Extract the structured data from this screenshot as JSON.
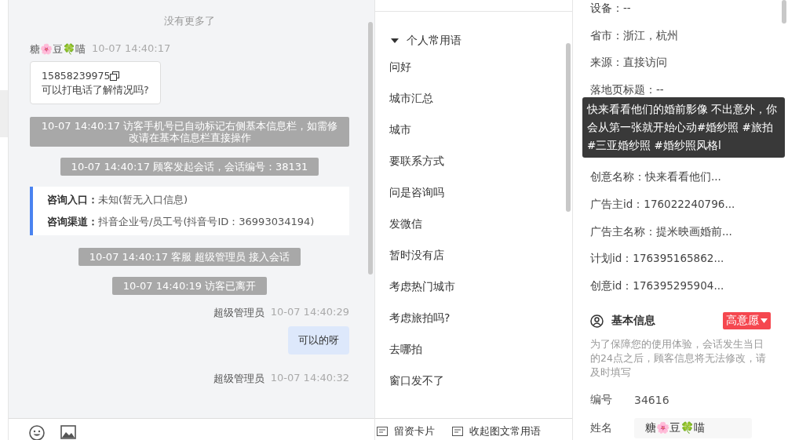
{
  "chat": {
    "no_more": "没有更多了",
    "messages": [
      {
        "kind": "visitor",
        "name": "糖🌸豆🍀喵",
        "time": "10-07 14:40:17",
        "phone": "15858239975",
        "text": "可以打电话了解情况吗?"
      },
      {
        "kind": "system",
        "text": "10-07 14:40:17 访客手机号已自动标记右侧基本信息栏，如需修改请在基本信息栏直接操作"
      },
      {
        "kind": "system",
        "text": "10-07 14:40:17 顾客发起会话，会话编号：38131"
      },
      {
        "kind": "entry",
        "rows": [
          {
            "label": "咨询入口：",
            "value": "未知(暂无入口信息)"
          },
          {
            "label": "咨询渠道：",
            "value": "抖音企业号/员工号(抖音号ID：36993034194)"
          }
        ]
      },
      {
        "kind": "system",
        "text": "10-07 14:40:17 客服 超级管理员 接入会话"
      },
      {
        "kind": "system",
        "text": "10-07 14:40:19 访客已离开"
      },
      {
        "kind": "agent",
        "name": "超级管理员",
        "time": "10-07 14:40:29",
        "text": "可以的呀"
      },
      {
        "kind": "agent",
        "name": "超级管理员",
        "time": "10-07 14:40:32"
      }
    ]
  },
  "phrases": {
    "group": "个人常用语",
    "expanded": true,
    "items": [
      "问好",
      "城市汇总",
      "城市",
      "要联系方式",
      "问是咨询吗",
      "发微信",
      "暂时没有店",
      "考虑热门城市",
      "考虑旅拍吗?",
      "去哪拍",
      "窗口发不了"
    ],
    "actions": [
      "留资卡片",
      "收起图文常用语"
    ]
  },
  "visitor_info": {
    "rows_before": [
      "设备：--",
      "省市：浙江，杭州",
      "来源：直接访问",
      "落地页标题：--"
    ],
    "tooltip": "快来看看他们的婚前影像 不出意外，你会从第一张就开始心动#婚纱照 #旅拍 #三亚婚纱照 #婚纱照风格l",
    "rows_after": [
      "创意名称：快来看看他们...",
      "广告主id：176022240796...",
      "广告主名称：提米映画婚前...",
      "计划id：176395165862...",
      "创意id：176395295904..."
    ]
  },
  "basic_info": {
    "title": "基本信息",
    "intent": "高意愿",
    "notice": "为了保障您的使用体验，会话发生当日的24点之后，顾客信息将无法修改，请及时填写",
    "fields": [
      {
        "kind": "text",
        "label": "编号",
        "value": "34616"
      },
      {
        "kind": "input",
        "label": "姓名",
        "value": "糖🌸豆🍀喵"
      }
    ]
  }
}
